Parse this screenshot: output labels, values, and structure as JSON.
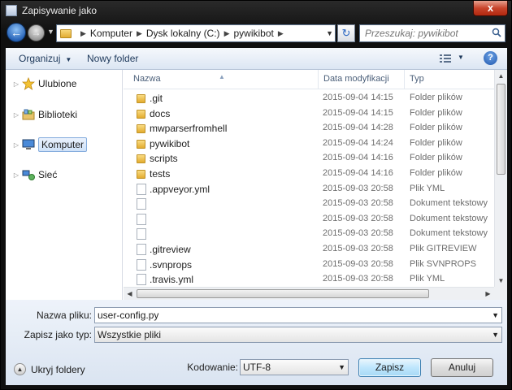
{
  "window": {
    "title": "Zapisywanie jako",
    "close_label": "x"
  },
  "nav": {
    "breadcrumbs": [
      "Komputer",
      "Dysk lokalny (C:)",
      "pywikibot"
    ],
    "search_placeholder": "Przeszukaj: pywikibot"
  },
  "toolbar": {
    "organize_label": "Organizuj",
    "new_folder_label": "Nowy folder",
    "help_label": "?"
  },
  "sidebar": {
    "items": [
      {
        "label": "Ulubione",
        "icon": "star-icon"
      },
      {
        "label": "Biblioteki",
        "icon": "library-icon"
      },
      {
        "label": "Komputer",
        "icon": "computer-icon",
        "selected": true
      },
      {
        "label": "Sieć",
        "icon": "network-icon"
      }
    ]
  },
  "columns": {
    "name": "Nazwa",
    "date": "Data modyfikacji",
    "type": "Typ"
  },
  "files": [
    {
      "name": ".git",
      "date": "2015-09-04 14:15",
      "type": "Folder plików",
      "kind": "folder"
    },
    {
      "name": "docs",
      "date": "2015-09-04 14:15",
      "type": "Folder plików",
      "kind": "folder"
    },
    {
      "name": "mwparserfromhell",
      "date": "2015-09-04 14:28",
      "type": "Folder plików",
      "kind": "folder"
    },
    {
      "name": "pywikibot",
      "date": "2015-09-04 14:24",
      "type": "Folder plików",
      "kind": "folder"
    },
    {
      "name": "scripts",
      "date": "2015-09-04 14:16",
      "type": "Folder plików",
      "kind": "folder"
    },
    {
      "name": "tests",
      "date": "2015-09-04 14:16",
      "type": "Folder plików",
      "kind": "folder"
    },
    {
      "name": ".appveyor.yml",
      "date": "2015-09-03 20:58",
      "type": "Plik YML",
      "kind": "file"
    },
    {
      "name": "",
      "date": "2015-09-03 20:58",
      "type": "Dokument tekstowy",
      "kind": "file"
    },
    {
      "name": "",
      "date": "2015-09-03 20:58",
      "type": "Dokument tekstowy",
      "kind": "file"
    },
    {
      "name": "",
      "date": "2015-09-03 20:58",
      "type": "Dokument tekstowy",
      "kind": "file"
    },
    {
      "name": ".gitreview",
      "date": "2015-09-03 20:58",
      "type": "Plik GITREVIEW",
      "kind": "file"
    },
    {
      "name": ".svnprops",
      "date": "2015-09-03 20:58",
      "type": "Plik SVNPROPS",
      "kind": "file"
    },
    {
      "name": ".travis.yml",
      "date": "2015-09-03 20:58",
      "type": "Plik YML",
      "kind": "file"
    }
  ],
  "form": {
    "filename_label": "Nazwa pliku:",
    "filename_value": "user-config.py",
    "filetype_label": "Zapisz jako typ:",
    "filetype_value": "Wszystkie pliki",
    "encoding_label": "Kodowanie:",
    "encoding_value": "UTF-8",
    "save_label": "Zapisz",
    "cancel_label": "Anuluj",
    "hide_folders_label": "Ukryj foldery"
  }
}
